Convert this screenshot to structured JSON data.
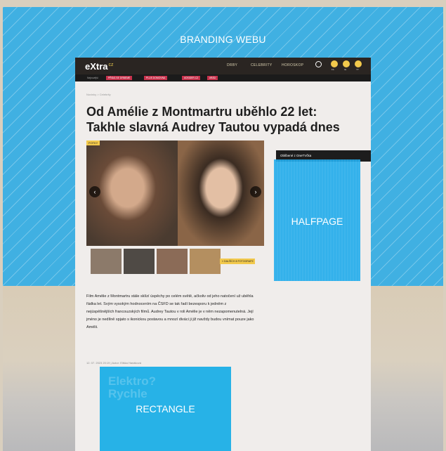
{
  "zones": {
    "branding": "BRANDING WEBU",
    "halfpage": "HALFPAGE",
    "rectangle": "RECTANGLE"
  },
  "site": {
    "logo": "eXtra",
    "logo_suffix": "cz",
    "nav": [
      "DRBY",
      "CELEBRITY",
      "HOROSKOP"
    ],
    "social": [
      "Fb",
      "IG",
      "YT"
    ]
  },
  "tags": [
    "Nejnovější",
    "PŘIDÁ SE DRBEME",
    "PLUS DOMOVNA",
    "#OSIDER.CZ",
    "#RÁD"
  ],
  "breadcrumb": "Novinky > Celebrity",
  "headline": "Od Amélie z Montmartru uběhlo 22 let: Takhle slavná Audrey Tautou vypadá dnes",
  "gallery": {
    "badge": "FOTKY",
    "link": "» DALŠÍCH 8 FOTOGRAFIÍ"
  },
  "sidebar": {
    "heading": "Oblíbené z OneTVčka"
  },
  "article": {
    "text": "Film Amélie z Montmartru stále sklízí úspěchy po celém světě, ačkoliv od jeho natočení už uběhla řádka let. Svým vysokým hodnocením na ČSFD se tak řadí bezesporu k jedněm z nejúspěšnějších francouzských filmů. Audrey Tautou v roli Amélie je v něm nezapomenutelná. Její jméno je nedílně spjato s ikonickou postavou a mnozí diváci ji již navždy budou vnímat pouze jako Amélii.",
    "meta": "12. 07. 2023 20:19 | Autor: Eliška Hanáková"
  },
  "rect_ghost": [
    "Elektro?",
    "Rychle"
  ],
  "colors": {
    "ad_blue": "#1eaaeb",
    "tag_red": "#c7324c",
    "accent_yellow": "#f2c94c",
    "topbar": "#2a2522"
  }
}
